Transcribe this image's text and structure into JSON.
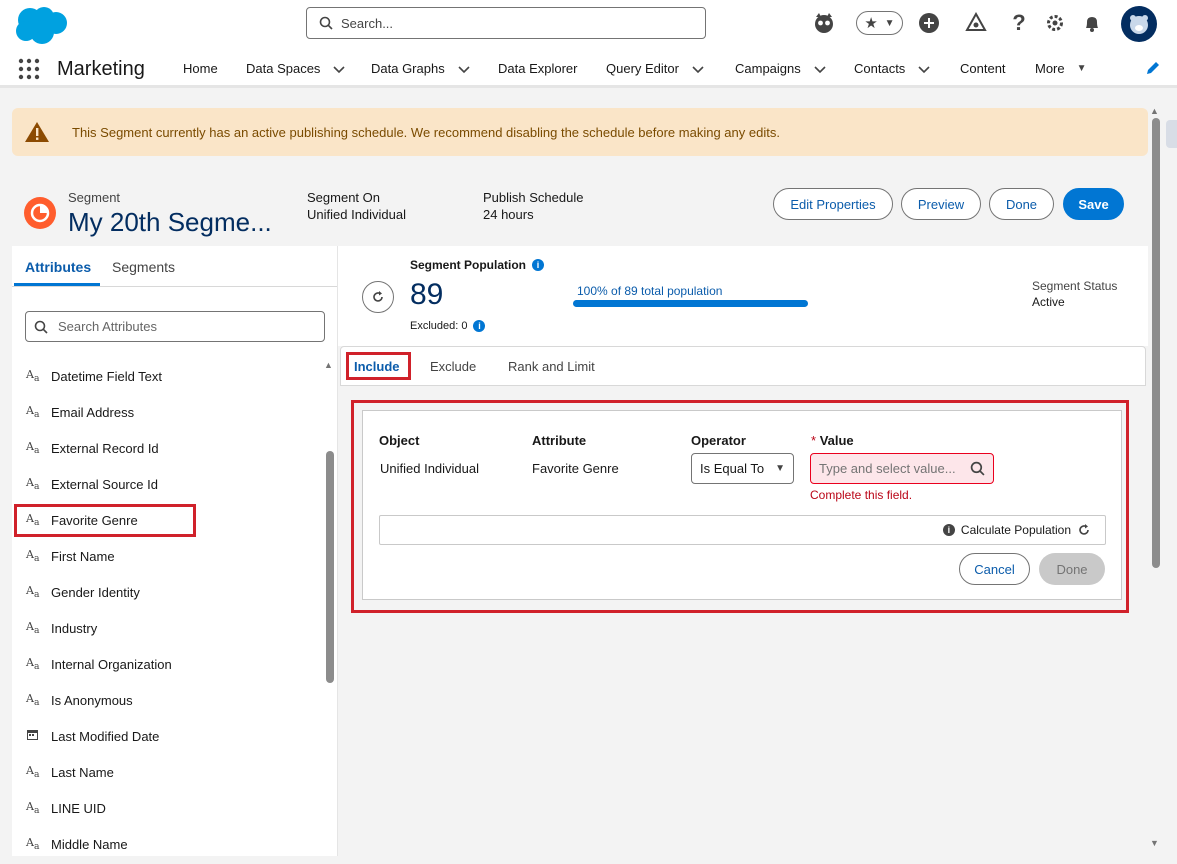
{
  "header": {
    "search_placeholder": "Search...",
    "app_name": "Marketing",
    "nav": [
      {
        "label": "Home",
        "dropdown": false
      },
      {
        "label": "Data Spaces",
        "dropdown": true
      },
      {
        "label": "Data Graphs",
        "dropdown": true
      },
      {
        "label": "Data Explorer",
        "dropdown": false
      },
      {
        "label": "Query Editor",
        "dropdown": true
      },
      {
        "label": "Campaigns",
        "dropdown": true
      },
      {
        "label": "Contacts",
        "dropdown": true
      },
      {
        "label": "Content",
        "dropdown": false
      },
      {
        "label": "More",
        "dropdown": true
      }
    ],
    "icons": [
      "trailhead-icon",
      "favorites-icon",
      "add-icon",
      "setup-assistant-icon",
      "help-icon",
      "gear-icon",
      "notifications-icon",
      "avatar"
    ]
  },
  "banner": {
    "text": "This Segment currently has an active publishing schedule. We recommend disabling the schedule before making any edits."
  },
  "segment": {
    "type_label": "Segment",
    "title": "My 20th Segme...",
    "on_label": "Segment On",
    "on_value": "Unified Individual",
    "schedule_label": "Publish Schedule",
    "schedule_value": "24 hours",
    "buttons": {
      "edit": "Edit Properties",
      "preview": "Preview",
      "done": "Done",
      "save": "Save"
    }
  },
  "left": {
    "tabs": [
      "Attributes",
      "Segments"
    ],
    "search_placeholder": "Search Attributes",
    "attributes": [
      {
        "label": "Datetime Field Text",
        "icon": "text"
      },
      {
        "label": "Email Address",
        "icon": "text"
      },
      {
        "label": "External Record Id",
        "icon": "text"
      },
      {
        "label": "External Source Id",
        "icon": "text"
      },
      {
        "label": "Favorite Genre",
        "icon": "text"
      },
      {
        "label": "First Name",
        "icon": "text"
      },
      {
        "label": "Gender Identity",
        "icon": "text"
      },
      {
        "label": "Industry",
        "icon": "text"
      },
      {
        "label": "Internal Organization",
        "icon": "text"
      },
      {
        "label": "Is Anonymous",
        "icon": "text"
      },
      {
        "label": "Last Modified Date",
        "icon": "calendar"
      },
      {
        "label": "Last Name",
        "icon": "text"
      },
      {
        "label": "LINE UID",
        "icon": "text"
      },
      {
        "label": "Middle Name",
        "icon": "text"
      }
    ]
  },
  "population": {
    "label": "Segment Population",
    "count": "89",
    "excluded": "Excluded: 0",
    "progress_text": "100% of 89 total population",
    "progress_fraction": 1.0,
    "status_label": "Segment Status",
    "status_value": "Active"
  },
  "canvas_tabs": [
    "Include",
    "Exclude",
    "Rank and Limit"
  ],
  "filter": {
    "headers": {
      "object": "Object",
      "attribute": "Attribute",
      "operator": "Operator",
      "value": "Value"
    },
    "required_mark": "*",
    "object": "Unified Individual",
    "attribute": "Favorite Genre",
    "operator": "Is Equal To",
    "value_placeholder": "Type and select value...",
    "error": "Complete this field.",
    "calculate": "Calculate Population",
    "cancel": "Cancel",
    "done": "Done"
  },
  "colors": {
    "brand": "#0176d3",
    "highlight": "#d0212a",
    "warning_bg": "#fae5c8",
    "error": "#ba0517"
  }
}
